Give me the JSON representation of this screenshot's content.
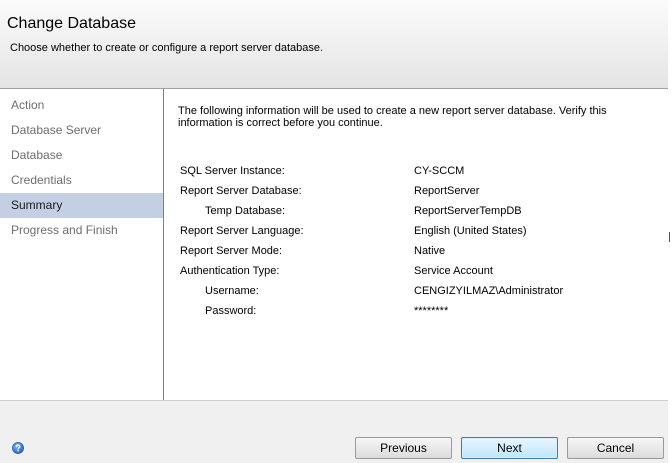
{
  "header": {
    "title": "Change Database",
    "subtitle": "Choose whether to create or configure a report server database."
  },
  "nav": {
    "items": [
      {
        "label": "Action",
        "selected": false
      },
      {
        "label": "Database Server",
        "selected": false
      },
      {
        "label": "Database",
        "selected": false
      },
      {
        "label": "Credentials",
        "selected": false
      },
      {
        "label": "Summary",
        "selected": true
      },
      {
        "label": "Progress and Finish",
        "selected": false
      }
    ]
  },
  "summary": {
    "intro": "The following information will be used to create a new report server database. Verify this information is correct before you continue.",
    "rows": [
      {
        "label": "SQL Server Instance:",
        "value": "CY-SCCM",
        "indent": false
      },
      {
        "label": "Report Server Database:",
        "value": "ReportServer",
        "indent": false
      },
      {
        "label": "Temp Database:",
        "value": "ReportServerTempDB",
        "indent": true
      },
      {
        "label": "Report Server Language:",
        "value": "English (United States)",
        "indent": false
      },
      {
        "label": "Report Server Mode:",
        "value": "Native",
        "indent": false
      },
      {
        "label": "Authentication Type:",
        "value": "Service Account",
        "indent": false
      },
      {
        "label": "Username:",
        "value": "CENGIZYILMAZ\\Administrator",
        "indent": true
      },
      {
        "label": "Password:",
        "value": "********",
        "indent": true
      }
    ]
  },
  "footer": {
    "help_icon": "help-icon",
    "previous_label": "Previous",
    "next_label": "Next",
    "cancel_label": "Cancel"
  },
  "colors": {
    "selected_nav": "#c3d0e4",
    "nav_text": "#6d6d6d",
    "default_button_border": "#3c7fb1",
    "help_icon_blue": "#1f5fbf"
  }
}
